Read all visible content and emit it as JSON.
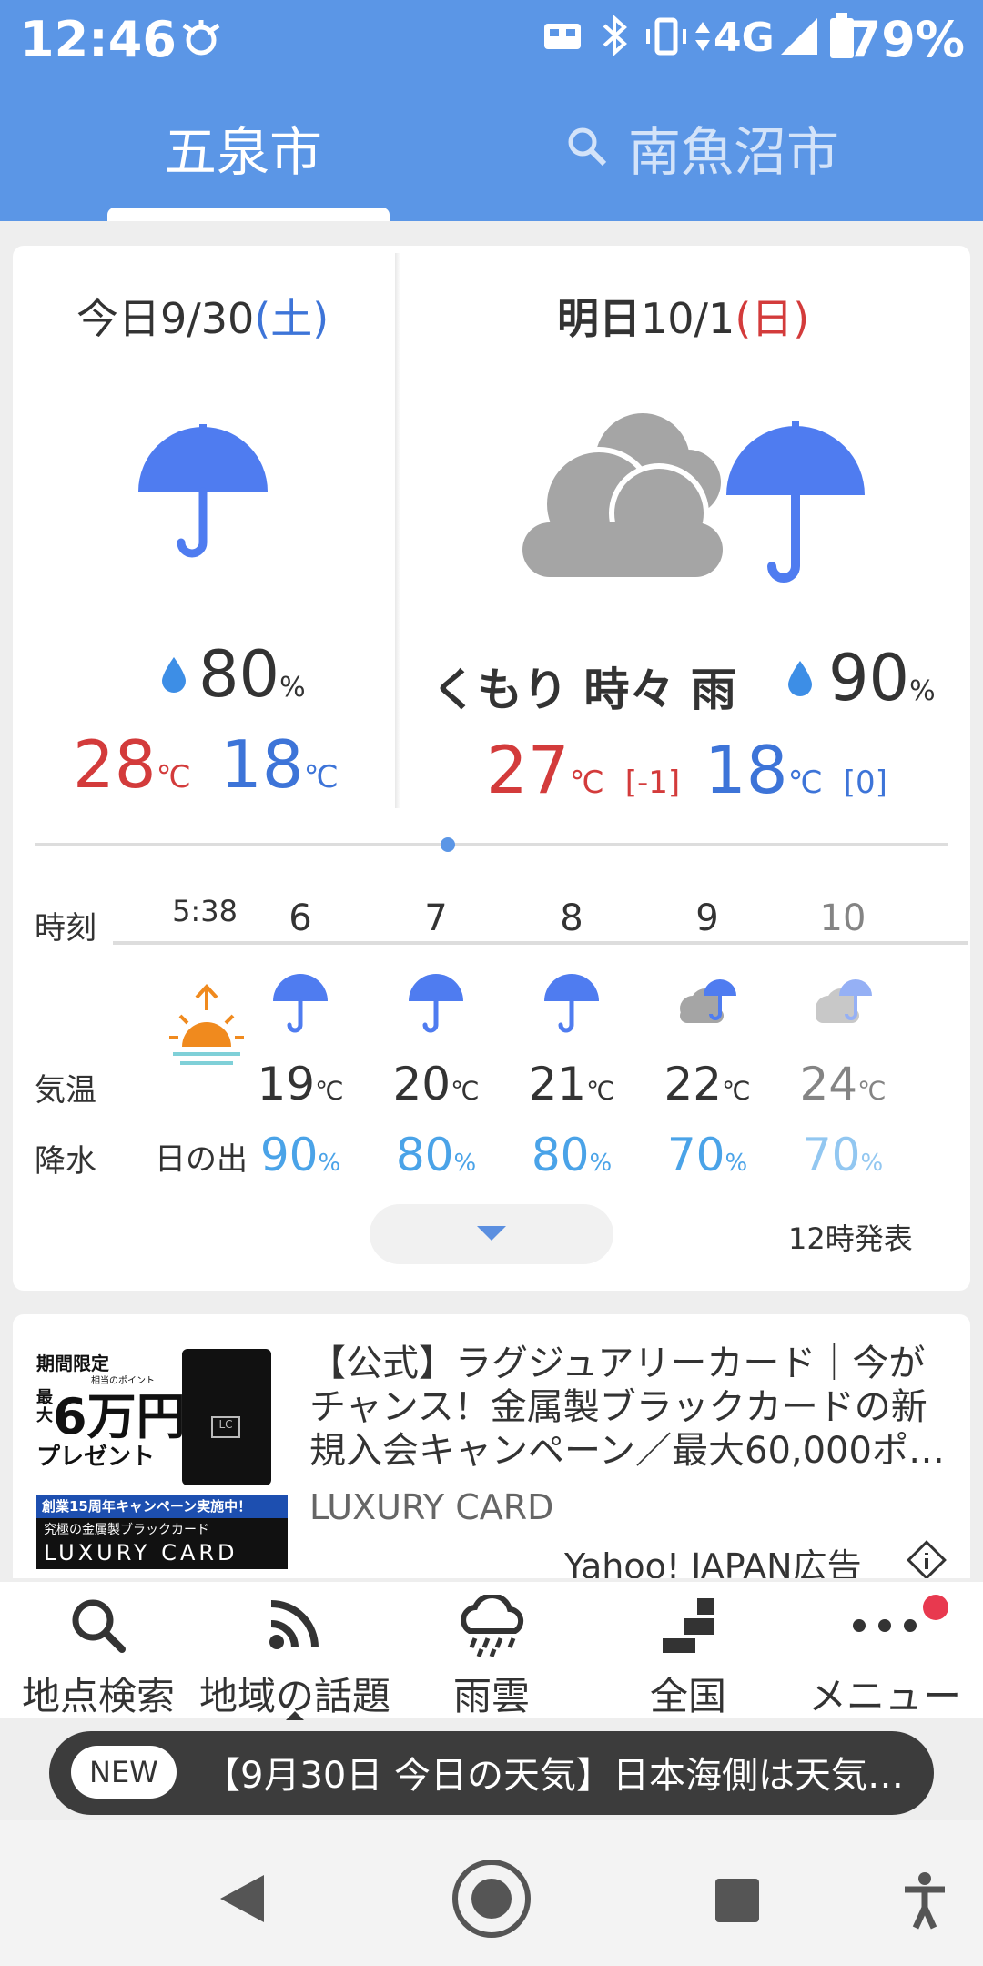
{
  "status": {
    "time": "12:46",
    "network": "4G",
    "battery": "79%"
  },
  "tabs": [
    {
      "label": "五泉市"
    },
    {
      "label": "南魚沼市"
    }
  ],
  "today": {
    "prefix": "今日",
    "date": "9/30",
    "day": "(土)",
    "rain_pct": "80",
    "high": "28",
    "low": "18"
  },
  "tomorrow": {
    "prefix": "明日",
    "date": "10/1",
    "day": "(日)",
    "condition": "くもり 時々 雨",
    "rain_pct": "90",
    "high": "27",
    "low": "18",
    "high_diff": "[-1]",
    "low_diff": "[0]"
  },
  "units": {
    "percent": "%",
    "celsius": "℃"
  },
  "hourly": {
    "row_labels": {
      "time": "時刻",
      "temp": "気温",
      "precip": "降水"
    },
    "sunrise": {
      "time": "5:38",
      "label": "日の出"
    },
    "hours": [
      "6",
      "7",
      "8",
      "9",
      "10"
    ],
    "temps": [
      "19",
      "20",
      "21",
      "22",
      "24"
    ],
    "precip": [
      "90",
      "80",
      "80",
      "70",
      "70"
    ],
    "icons": [
      "umbrella-icon",
      "umbrella-icon",
      "umbrella-icon",
      "cloud-umbrella-icon",
      "cloud-umbrella-icon"
    ]
  },
  "issued": "12時発表",
  "ad": {
    "headline": "【公式】ラグジュアリーカード｜今がチャンス！金属製ブラックカードの新規入会キャンペーン／最大60,000ポ…",
    "source": "LUXURY CARD",
    "sponsor": "Yahoo! JAPAN広告",
    "banner": {
      "line1": "期間限定",
      "max": "最大",
      "amount": "6万円",
      "sub": "相当のポイント",
      "present": "プレゼント",
      "campaign": "創業15周年キャンペーン実施中！",
      "tagline": "究極の金属製ブラックカード",
      "brand": "LUXURY CARD"
    }
  },
  "nav": [
    {
      "label": "地点検索"
    },
    {
      "label": "地域の話題"
    },
    {
      "label": "雨雲"
    },
    {
      "label": "全国"
    },
    {
      "label": "メニュー"
    }
  ],
  "news": {
    "badge": "NEW",
    "text": "【9月30日 今日の天気】日本海側は天気…"
  },
  "colors": {
    "header": "#5b96e6",
    "umbrella": "#4f7cf0",
    "cloud": "#a5a5a5",
    "temp_high": "#d33b3b",
    "temp_low": "#3d74d8",
    "precip": "#4aa3e8"
  }
}
